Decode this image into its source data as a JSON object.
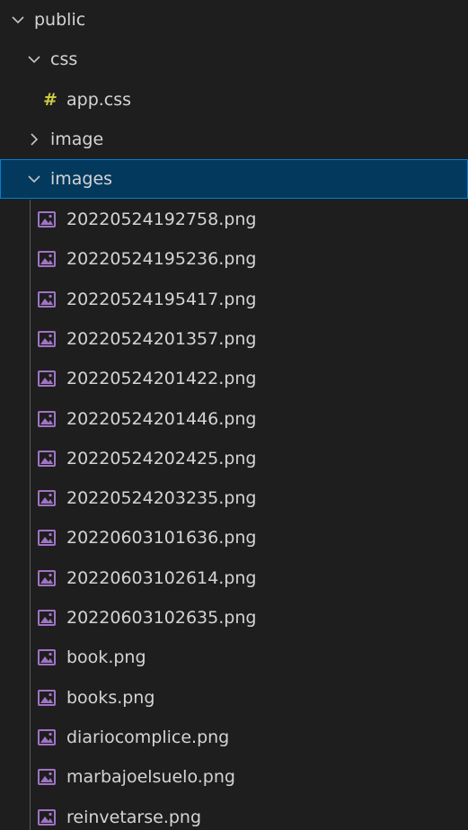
{
  "explorer": {
    "folders": {
      "public": "public",
      "css": "css",
      "image": "image",
      "images": "images"
    },
    "css_files": [
      "app.css"
    ],
    "image_files": [
      "20220524192758.png",
      "20220524195236.png",
      "20220524195417.png",
      "20220524201357.png",
      "20220524201422.png",
      "20220524201446.png",
      "20220524202425.png",
      "20220524203235.png",
      "20220603101636.png",
      "20220603102614.png",
      "20220603102635.png",
      "book.png",
      "books.png",
      "diariocomplice.png",
      "marbajoelsuelo.png",
      "reinvetarse.png"
    ],
    "css_icon_glyph": "#",
    "colors": {
      "background": "#1e1e1e",
      "selected_background": "#04395e",
      "selected_border": "#007fd4",
      "css_icon": "#cbcb41",
      "image_icon": "#a074c4"
    },
    "icons": {
      "expanded": "chevron-down-icon",
      "collapsed": "chevron-right-icon",
      "css_file": "hash-icon",
      "image_file": "image-file-icon"
    }
  }
}
